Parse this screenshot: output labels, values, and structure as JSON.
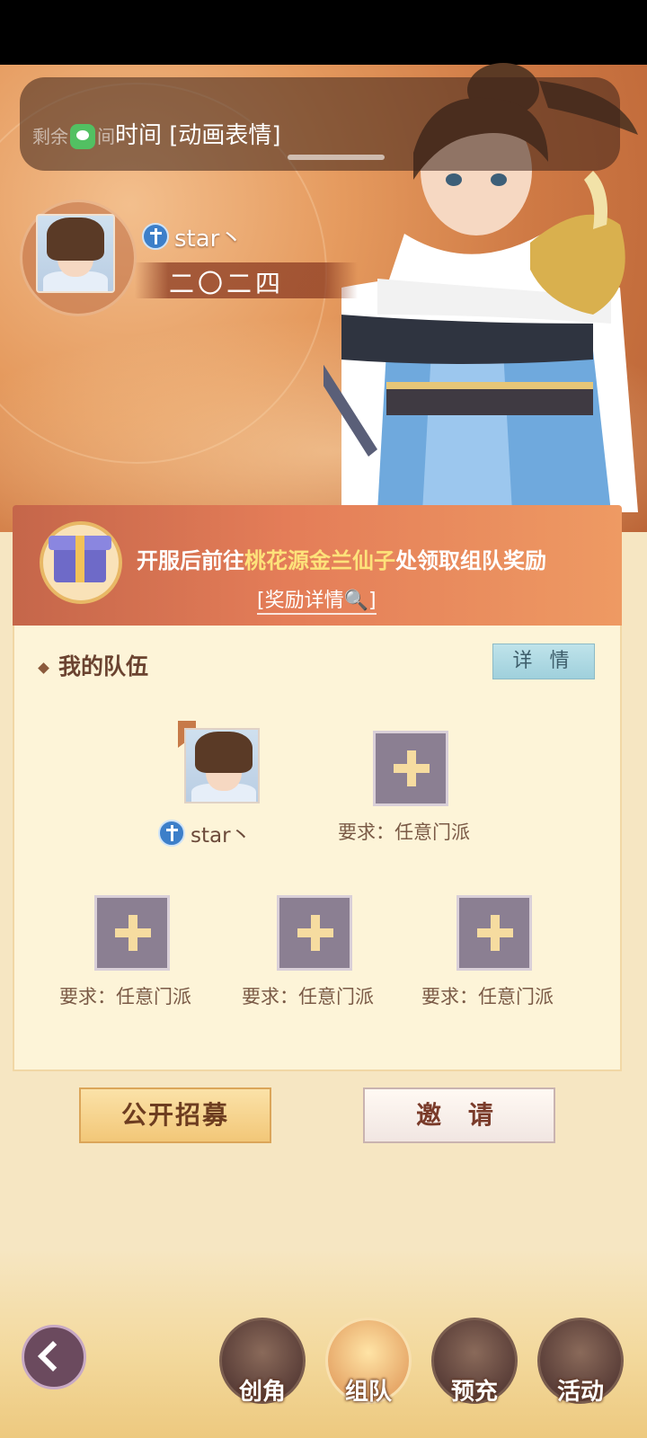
{
  "notification": {
    "text": "剩余 间时间 [动画表情]",
    "prefix": "剩余",
    "fragment": "间",
    "main": "时间 [动画表情]"
  },
  "player": {
    "name": "star丶",
    "title": "二〇二四"
  },
  "reward_banner": {
    "text_before": "开服后前往",
    "highlight": "桃花源金兰仙子",
    "text_after": "处领取组队奖励",
    "link_label": "[奖励详情🔍]"
  },
  "team": {
    "title": "我的队伍",
    "detail_button": "详 情",
    "members": [
      {
        "name": "star丶"
      }
    ],
    "slots": [
      {
        "requirement": "要求：任意门派"
      },
      {
        "requirement": "要求：任意门派"
      },
      {
        "requirement": "要求：任意门派"
      },
      {
        "requirement": "要求：任意门派"
      }
    ]
  },
  "actions": {
    "recruit": "公开招募",
    "invite": "邀 请"
  },
  "bottom_nav": [
    {
      "label": "创角",
      "icon": "character-icon"
    },
    {
      "label": "组队",
      "icon": "team-icon",
      "active": true
    },
    {
      "label": "预充",
      "icon": "precharge-icon"
    },
    {
      "label": "活动",
      "icon": "activity-icon"
    }
  ]
}
